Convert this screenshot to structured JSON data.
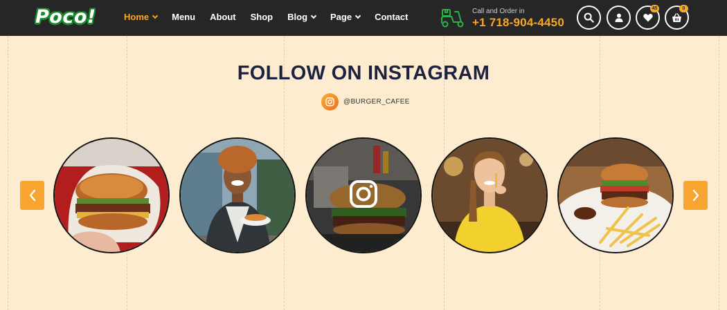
{
  "header": {
    "logo": "Poco!",
    "nav": [
      {
        "label": "Home",
        "has_dropdown": true,
        "active": true
      },
      {
        "label": "Menu",
        "has_dropdown": false,
        "active": false
      },
      {
        "label": "About",
        "has_dropdown": false,
        "active": false
      },
      {
        "label": "Shop",
        "has_dropdown": false,
        "active": false
      },
      {
        "label": "Blog",
        "has_dropdown": true,
        "active": false
      },
      {
        "label": "Page",
        "has_dropdown": true,
        "active": false
      },
      {
        "label": "Contact",
        "has_dropdown": false,
        "active": false
      }
    ],
    "call_label": "Call and Order in",
    "phone": "+1 718-904-4450",
    "wishlist_count": "45",
    "cart_count": "0",
    "icons": [
      "scooter-icon",
      "search-icon",
      "user-icon",
      "heart-icon",
      "basket-icon"
    ]
  },
  "section": {
    "title": "FOLLOW ON INSTAGRAM",
    "handle": "@BURGER_CAFEE",
    "photos": [
      "burger-in-hand",
      "man-with-food-truck",
      "burger-and-fries",
      "woman-eating-fries",
      "burger-with-fries-plate"
    ]
  },
  "colors": {
    "header_bg": "#262626",
    "accent": "#f9a825",
    "page_bg": "#fdecd0",
    "title": "#1d2240",
    "arrow_bg": "#f7a431"
  }
}
